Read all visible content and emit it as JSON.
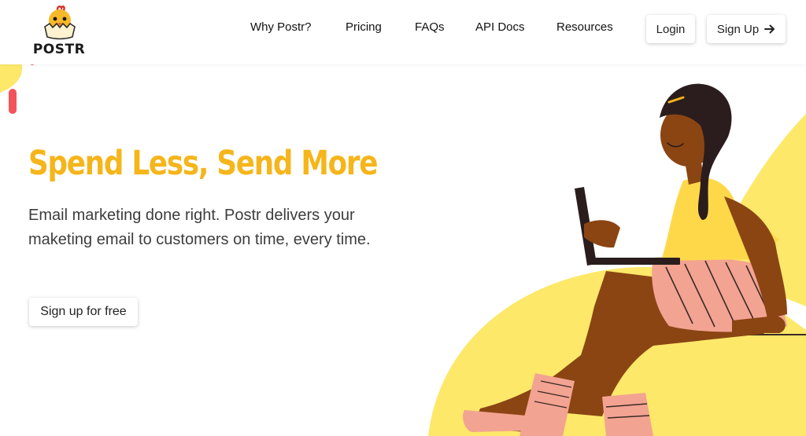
{
  "header": {
    "logo": {
      "text": "POSTR",
      "icon": "chick-icon"
    },
    "nav": [
      {
        "label": "Why Postr?"
      },
      {
        "label": "Pricing"
      },
      {
        "label": "FAQs"
      },
      {
        "label": "API Docs"
      },
      {
        "label": "Resources"
      }
    ],
    "login_label": "Login",
    "signup_label": "Sign Up",
    "signup_icon": "arrow-right-icon"
  },
  "hero": {
    "title": "Spend Less, Send More",
    "description": "Email marketing done right. Postr delivers your maketing email to customers on time, every time.",
    "cta_label": "Sign up for free",
    "illustration": "woman-with-laptop-illustration"
  },
  "colors": {
    "accent": "#f5b51b",
    "shape_yellow": "#fde86a",
    "skin": "#8b4513",
    "shorts": "#f3a392",
    "top": "#ffd84a",
    "deco_red": "#f2545b"
  }
}
